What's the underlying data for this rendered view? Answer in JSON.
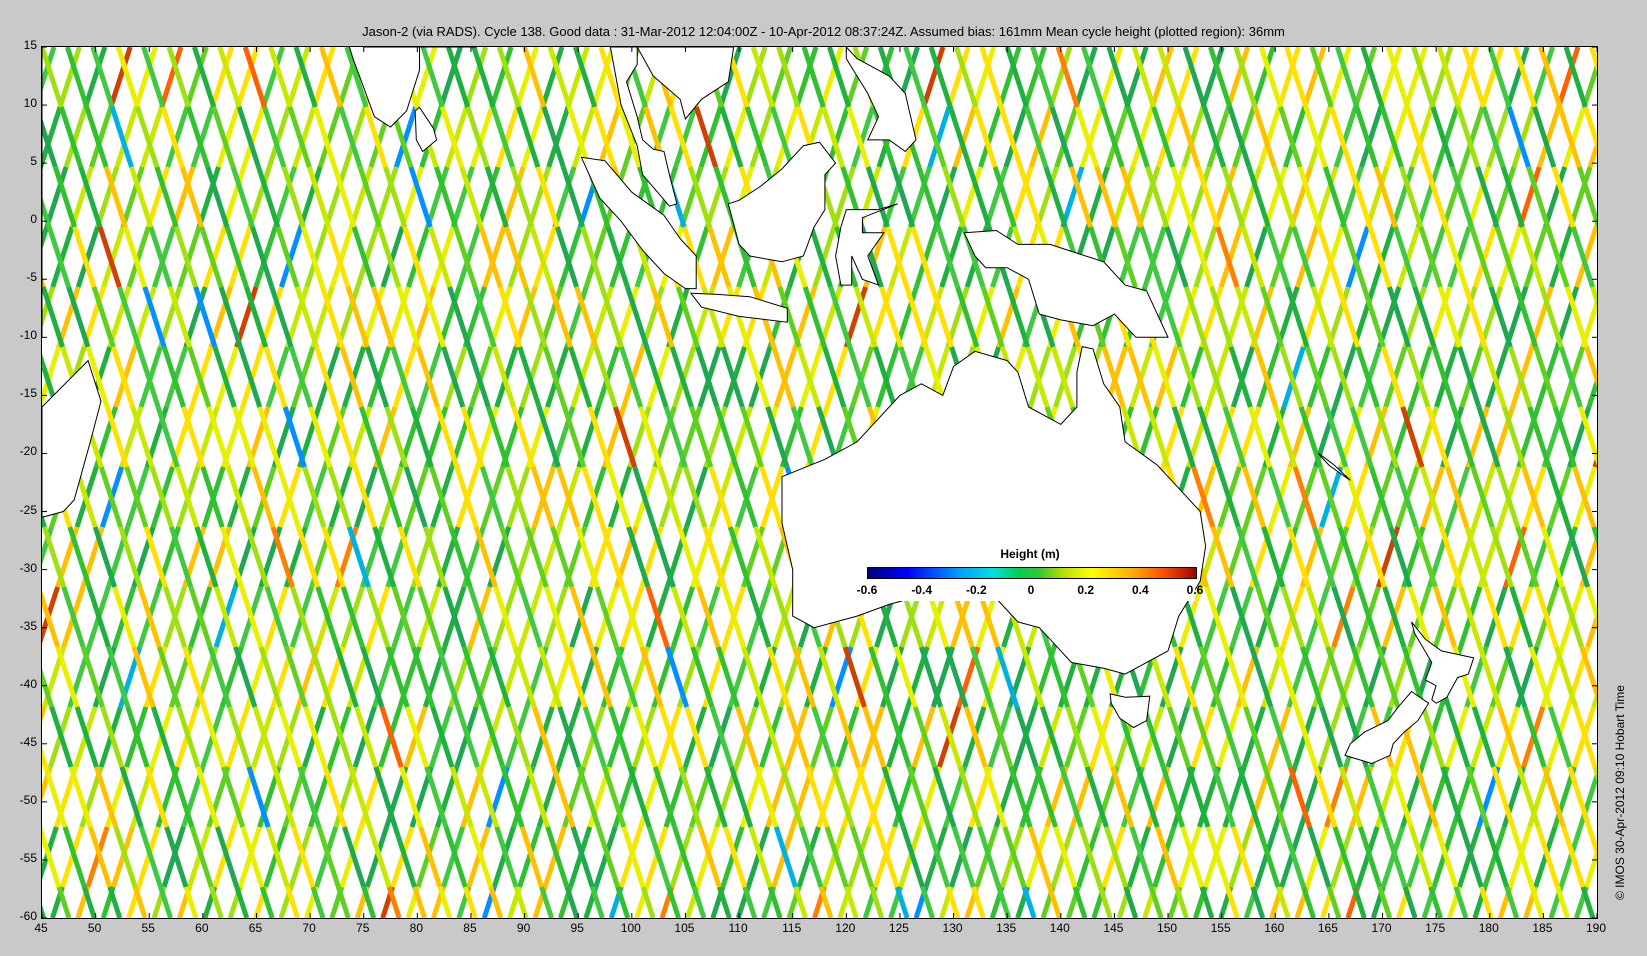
{
  "title": "Jason-2 (via RADS). Cycle 138. Good data : 31-Mar-2012 12:04:00Z - 10-Apr-2012 08:37:24Z. Assumed bias: 161mm  Mean cycle height (plotted region): 36mm",
  "credit": "© IMOS 30-Apr-2012 09:10 Hobart Time",
  "axes": {
    "x_range": [
      45,
      190
    ],
    "y_range": [
      -60,
      15
    ],
    "x_ticks": [
      "45",
      "50",
      "55",
      "60",
      "65",
      "70",
      "75",
      "80",
      "85",
      "90",
      "95",
      "100",
      "105",
      "110",
      "115",
      "120",
      "125",
      "130",
      "135",
      "140",
      "145",
      "150",
      "155",
      "160",
      "165",
      "170",
      "175",
      "180",
      "185",
      "190"
    ],
    "y_ticks": [
      "15",
      "10",
      "5",
      "0",
      "-5",
      "-10",
      "-15",
      "-20",
      "-25",
      "-30",
      "-35",
      "-40",
      "-45",
      "-50",
      "-55",
      "-60"
    ]
  },
  "colorbar": {
    "title": "Height (m)",
    "labels": [
      "-0.6",
      "-0.4",
      "-0.2",
      "0",
      "0.2",
      "0.4",
      "0.6"
    ],
    "range": [
      -0.6,
      0.6
    ]
  },
  "colors": {
    "land": "#ffffff",
    "coast": "#000000",
    "background": "#c9c9c9"
  }
}
